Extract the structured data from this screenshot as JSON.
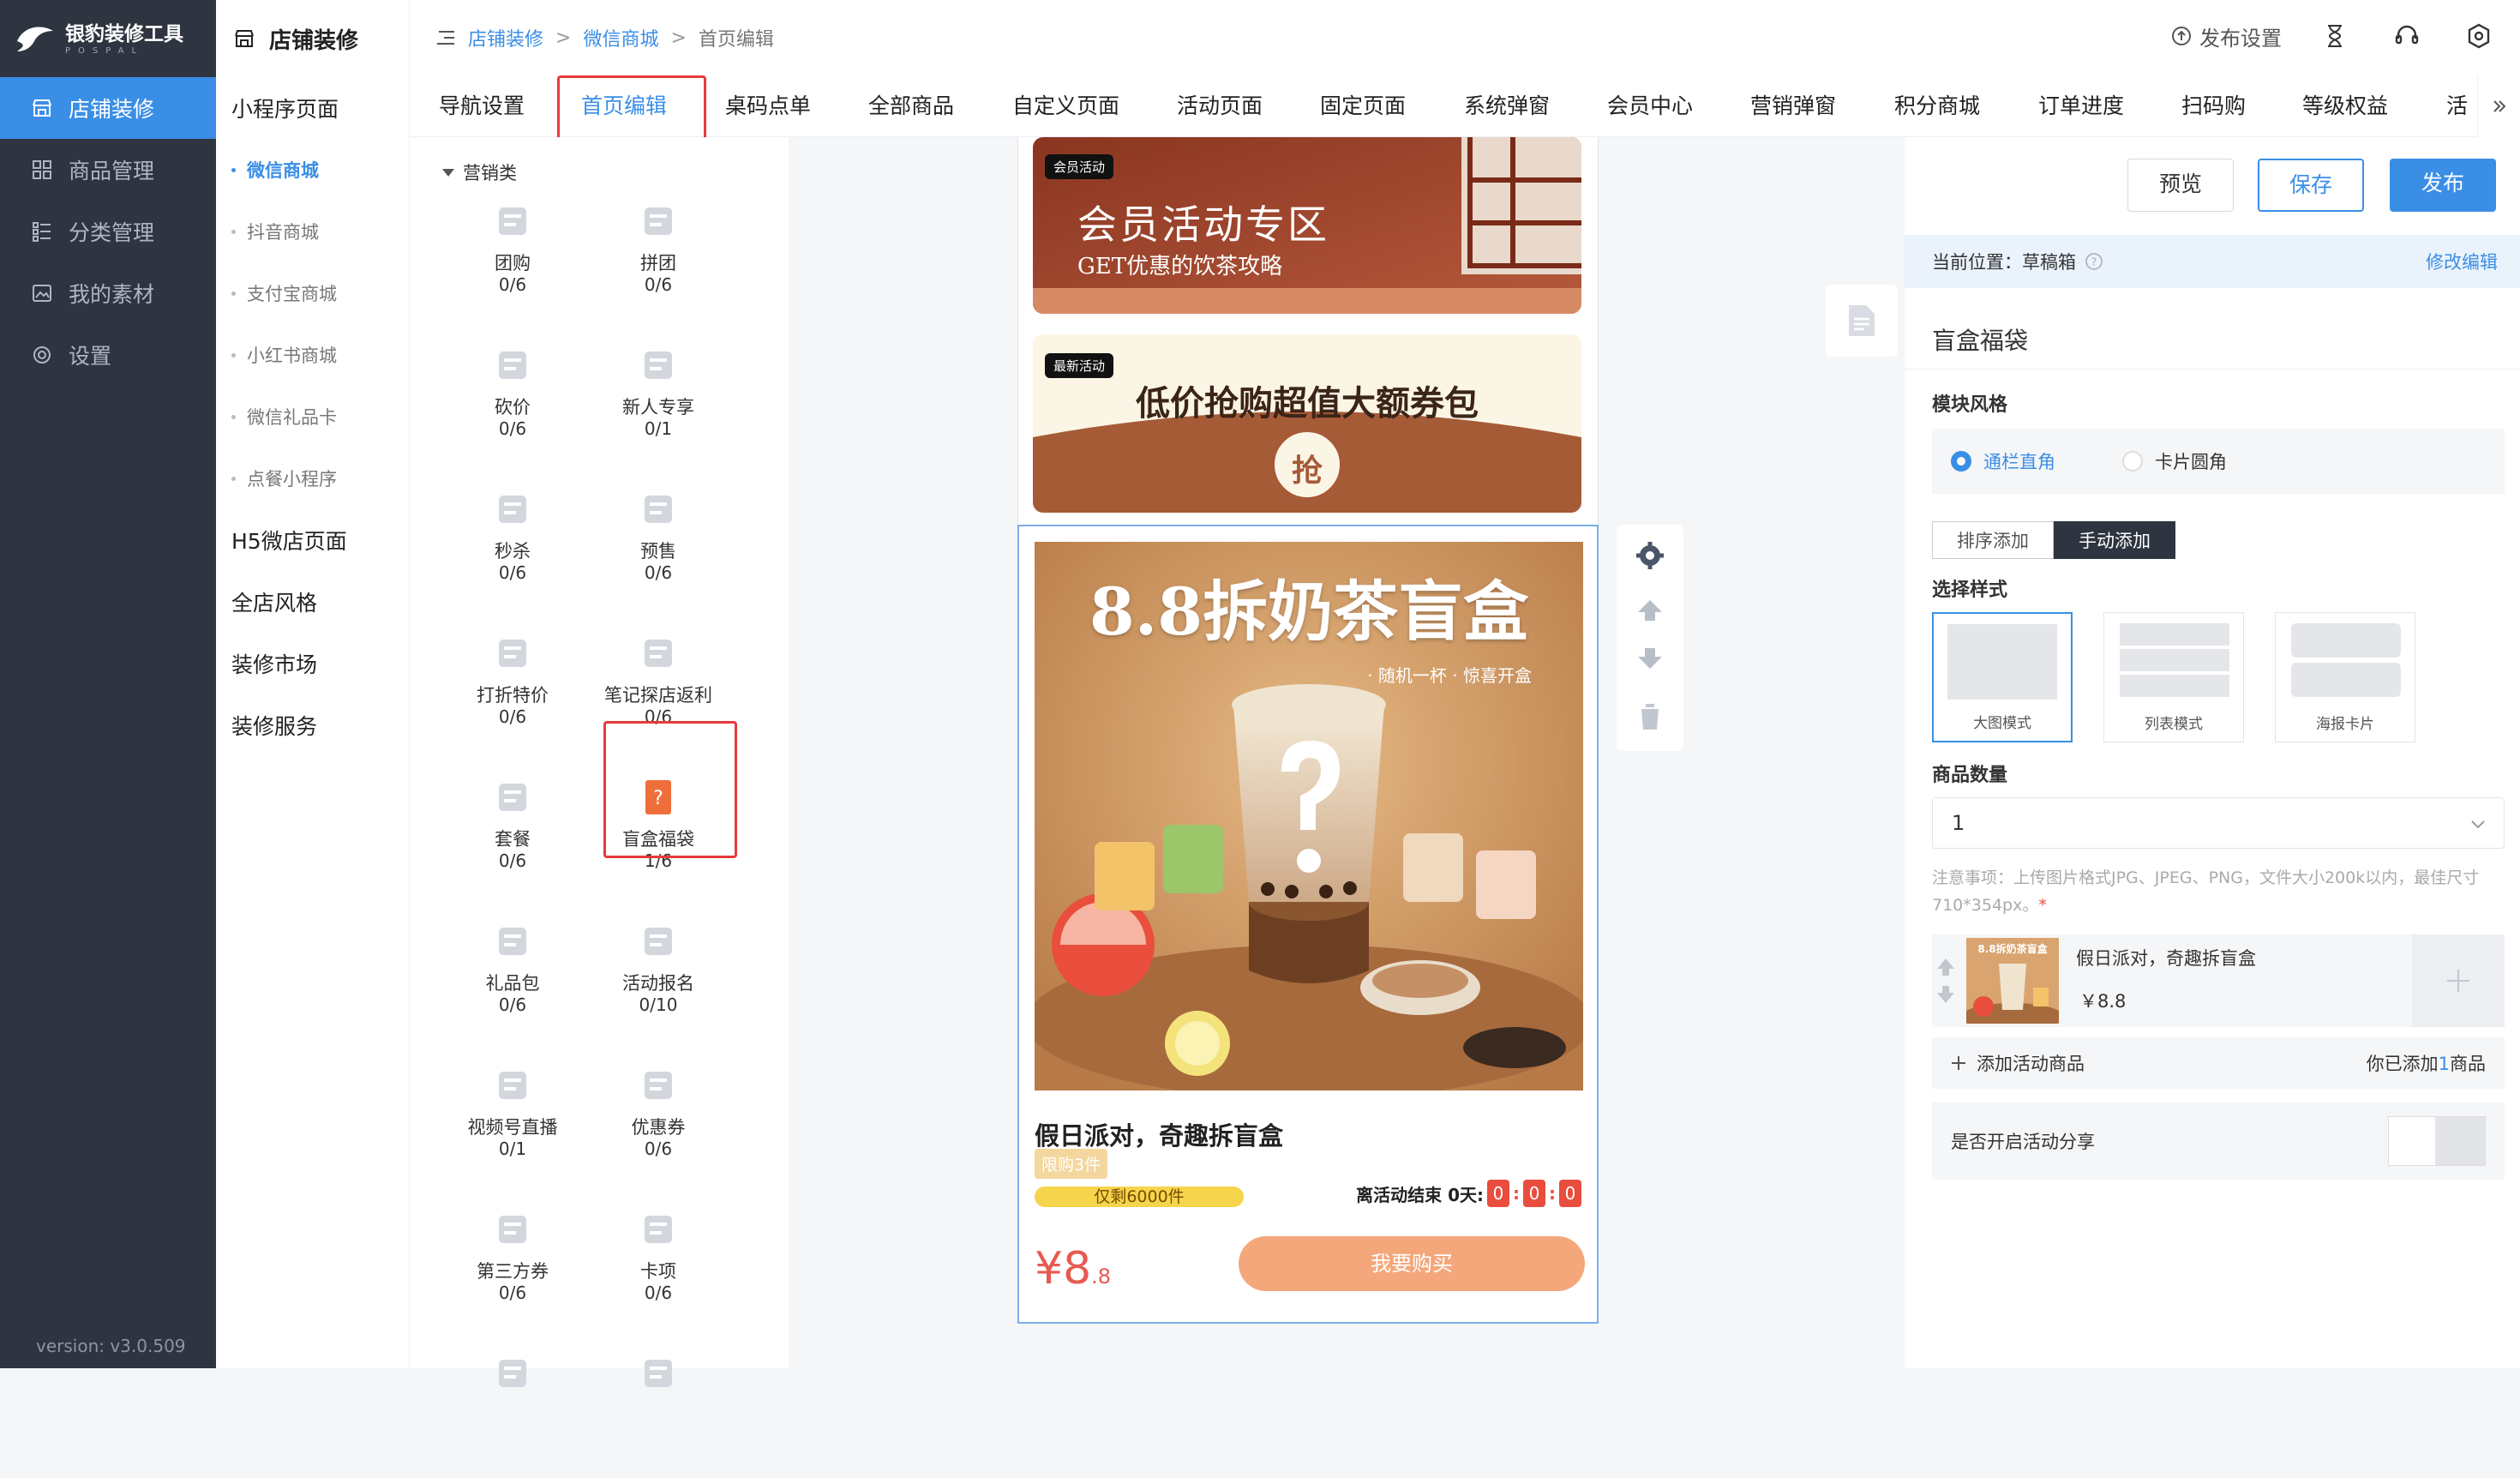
{
  "brand": {
    "name": "银豹装修工具",
    "sub": "POSPAL"
  },
  "nav": [
    {
      "label": "店铺装修",
      "icon": "store-icon"
    },
    {
      "label": "商品管理",
      "icon": "grid-icon"
    },
    {
      "label": "分类管理",
      "icon": "list-icon"
    },
    {
      "label": "我的素材",
      "icon": "image-icon"
    },
    {
      "label": "设置",
      "icon": "gear-icon"
    }
  ],
  "version": "version: v3.0.509",
  "sub": {
    "title": "店铺装修",
    "groups": [
      "小程序页面",
      "H5微店页面",
      "全店风格",
      "装修市场",
      "装修服务"
    ],
    "items": [
      "微信商城",
      "抖音商城",
      "支付宝商城",
      "小红书商城",
      "微信礼品卡",
      "点餐小程序"
    ]
  },
  "crumb": {
    "a": "店铺装修",
    "b": "微信商城",
    "c": "首页编辑",
    "sep": ">"
  },
  "top": {
    "publish_settings": "发布设置"
  },
  "tabs": [
    "导航设置",
    "首页编辑",
    "桌码点单",
    "全部商品",
    "自定义页面",
    "活动页面",
    "固定页面",
    "系统弹窗",
    "会员中心",
    "营销弹窗",
    "积分商城",
    "订单进度",
    "扫码购",
    "等级权益",
    "活"
  ],
  "components": {
    "group": "营销类",
    "items": [
      {
        "name": "团购",
        "count": "0/6",
        "icon": "group-buy-icon"
      },
      {
        "name": "拼团",
        "count": "0/6",
        "icon": "puzzle-icon"
      },
      {
        "name": "砍价",
        "count": "0/6",
        "icon": "tag-icon"
      },
      {
        "name": "新人专享",
        "count": "0/1",
        "icon": "new-user-tag-icon"
      },
      {
        "name": "秒杀",
        "count": "0/6",
        "icon": "lightning-icon"
      },
      {
        "name": "预售",
        "count": "0/6",
        "icon": "clock-icon"
      },
      {
        "name": "打折特价",
        "count": "0/6",
        "icon": "discount-icon"
      },
      {
        "name": "笔记探店返利",
        "count": "0/6",
        "icon": "note-discount-icon"
      },
      {
        "name": "套餐",
        "count": "0/6",
        "icon": "combo-icon"
      },
      {
        "name": "盲盒福袋",
        "count": "1/6",
        "icon": "blind-box-icon"
      },
      {
        "name": "礼品包",
        "count": "0/6",
        "icon": "gift-icon"
      },
      {
        "name": "活动报名",
        "count": "0/10",
        "icon": "signup-icon"
      },
      {
        "name": "视频号直播",
        "count": "0/1",
        "icon": "video-icon"
      },
      {
        "name": "优惠券",
        "count": "0/6",
        "icon": "coupon-icon"
      },
      {
        "name": "第三方券",
        "count": "0/6",
        "icon": "ticket-icon"
      },
      {
        "name": "卡项",
        "count": "0/6",
        "icon": "card-icon"
      },
      {
        "name": "",
        "count": "",
        "icon": "mail-icon"
      },
      {
        "name": "",
        "count": "",
        "icon": "mail-icon"
      }
    ]
  },
  "preview": {
    "banner1": {
      "tag": "会员活动",
      "title": "会员活动专区",
      "sub": "GET优惠的饮茶攻略"
    },
    "banner2": {
      "tag": "最新活动",
      "title": "低价抢购超值大额券包",
      "seal": "抢"
    },
    "poster": {
      "title": "8.8拆奶茶盲盒",
      "sub": "· 随机一杯 · 惊喜开盒"
    },
    "product": {
      "name": "假日派对，奇趣拆盲盒",
      "limit": "限购3件",
      "stock": "仅剩6000件",
      "countdown_label": "离活动结束 0天:",
      "cd": [
        "0",
        "0",
        "0"
      ],
      "colon": ":",
      "price_main": "¥8",
      "price_dec": ".8",
      "buy": "我要购买"
    }
  },
  "panel": {
    "buttons": {
      "preview": "预览",
      "save": "保存",
      "publish": "发布"
    },
    "location": "当前位置：草稿箱",
    "edit": "修改编辑",
    "title": "盲盒福袋",
    "style_label": "模块风格",
    "style_opts": [
      "通栏直角",
      "卡片圆角"
    ],
    "seg": [
      "排序添加",
      "手动添加"
    ],
    "choose_label": "选择样式",
    "shapes": [
      "大图模式",
      "列表模式",
      "海报卡片"
    ],
    "qty_label": "商品数量",
    "qty": "1",
    "note": "注意事项：上传图片格式JPG、JPEG、PNG，文件大小200k以内，最佳尺寸710*354px。",
    "star": "*",
    "item": {
      "name": "假日派对，奇趣拆盲盒",
      "price": "￥8.8",
      "thumb": "8.8拆奶茶盲盒"
    },
    "add": "添加活动商品",
    "added_prefix": "你已添加",
    "added_num": "1",
    "added_suffix": "商品",
    "share": "是否开启活动分享"
  },
  "colors": {
    "accent": "#3a8ee6",
    "sidebar": "#2e3440",
    "highlight": "#e8393d"
  }
}
